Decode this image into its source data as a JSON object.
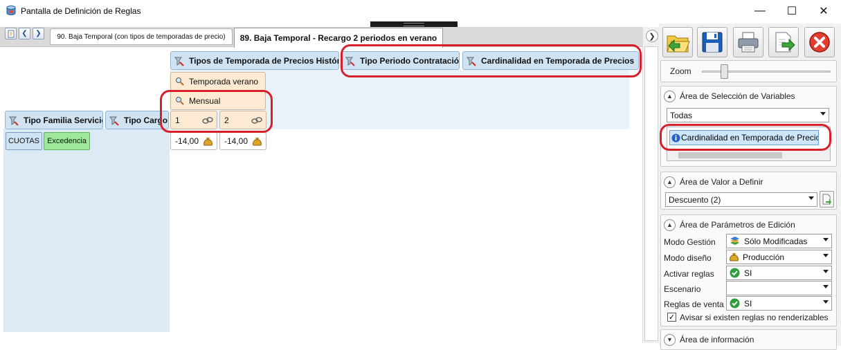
{
  "window": {
    "title": "Pantalla de Definición de Reglas",
    "minimize": "—",
    "maximize": "☐",
    "close": "✕"
  },
  "tabs": [
    {
      "label": "90. Baja Temporal (con tipos de temporadas de precio)"
    },
    {
      "label": "89. Baja Temporal - Recargo 2 periodos en verano"
    }
  ],
  "rule": {
    "left_headers": [
      "Tipo Familia Servicio",
      "Tipo Cargo"
    ],
    "left_values": [
      "CUOTAS",
      "Excedencia"
    ],
    "top_headers": [
      "Tipos de Temporada de Precios Histórica",
      "Tipo Periodo Contratación",
      "Cardinalidad en Temporada de Precios"
    ],
    "season": "Temporada verano",
    "period": "Mensual",
    "cardinalities": [
      "1",
      "2"
    ],
    "values": [
      "-14,00",
      "-14,00"
    ]
  },
  "panel": {
    "zoom_label": "Zoom",
    "zoom_level": 0.17,
    "variables": {
      "title": "Área de Selección de Variables",
      "filter": "Todas",
      "selected": "Cardinalidad en Temporada de Precios"
    },
    "value": {
      "title": "Área de Valor a Definir",
      "selected": "Descuento (2)"
    },
    "params": {
      "title": "Área de Parámetros de Edición",
      "rows": [
        {
          "label": "Modo Gestión",
          "value": "Sólo Modificadas",
          "icon": "stack-icon"
        },
        {
          "label": "Modo diseño",
          "value": "Producción",
          "icon": "money-bag-icon"
        },
        {
          "label": "Activar reglas",
          "value": "SI",
          "icon": "check-icon"
        },
        {
          "label": "Escenario",
          "value": "",
          "icon": ""
        },
        {
          "label": "Reglas de venta",
          "value": "SI",
          "icon": "check-icon"
        }
      ],
      "checkbox_label": "Avisar si existen reglas no renderizables",
      "checkbox_checked": true
    },
    "info": {
      "title": "Área de información"
    }
  },
  "colors": {
    "header_bg": "#cfe3f3",
    "cell_bg": "#fcebd2",
    "highlight": "#d8202a",
    "green_tag": "#9ee89a",
    "blue_tag": "#cfe3f3"
  }
}
